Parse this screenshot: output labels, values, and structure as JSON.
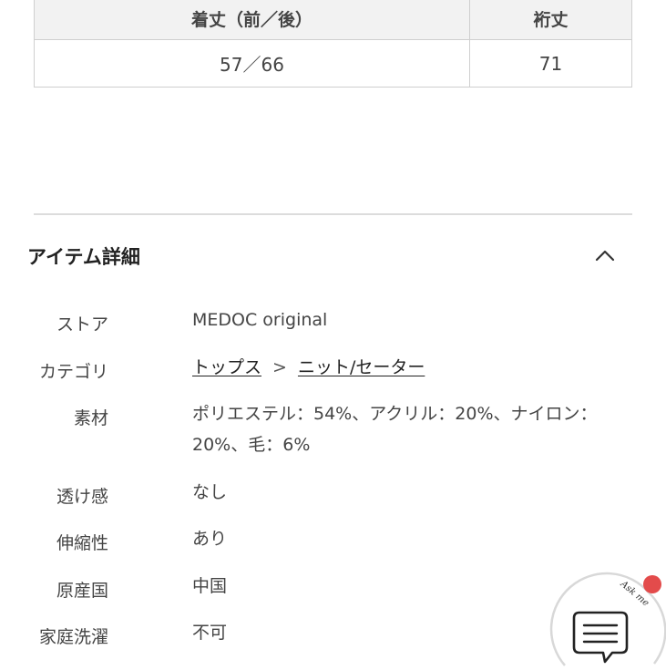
{
  "size_table": {
    "headers": [
      "着丈（前／後）",
      "裄丈"
    ],
    "row": [
      "57／66",
      "71"
    ]
  },
  "item_details": {
    "title": "アイテム詳細",
    "rows": [
      {
        "label": "ストア",
        "value": "MEDOC original"
      },
      {
        "label": "カテゴリ",
        "links": [
          "トップス",
          "ニット/セーター"
        ],
        "separator": ">"
      },
      {
        "label": "素材",
        "value": "ポリエステル：54%、アクリル：20%、ナイロン：20%、毛：6%"
      },
      {
        "label": "透け感",
        "value": "なし"
      },
      {
        "label": "伸縮性",
        "value": "あり"
      },
      {
        "label": "原産国",
        "value": "中国"
      },
      {
        "label": "家庭洗濯",
        "value": "不可"
      }
    ]
  },
  "chat_widget": {
    "label": "Ask me",
    "icon": "chat-bubble-icon",
    "notification_color": "#e34b4b"
  }
}
